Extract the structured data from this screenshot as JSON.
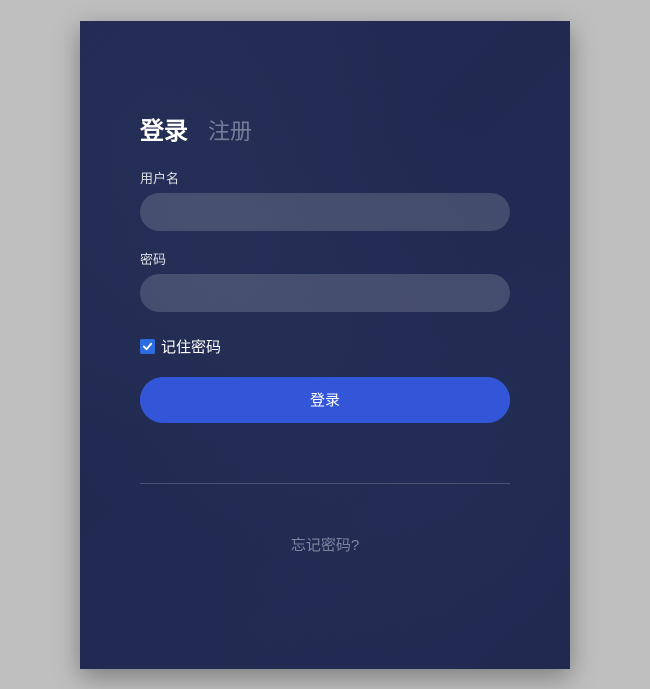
{
  "tabs": {
    "login": "登录",
    "register": "注册"
  },
  "fields": {
    "username_label": "用户名",
    "username_value": "",
    "password_label": "密码",
    "password_value": ""
  },
  "remember": {
    "label": "记住密码",
    "checked": true
  },
  "submit_label": "登录",
  "forgot_label": "忘记密码?",
  "colors": {
    "accent": "#3356d8",
    "checkbox": "#2d6cdf"
  }
}
